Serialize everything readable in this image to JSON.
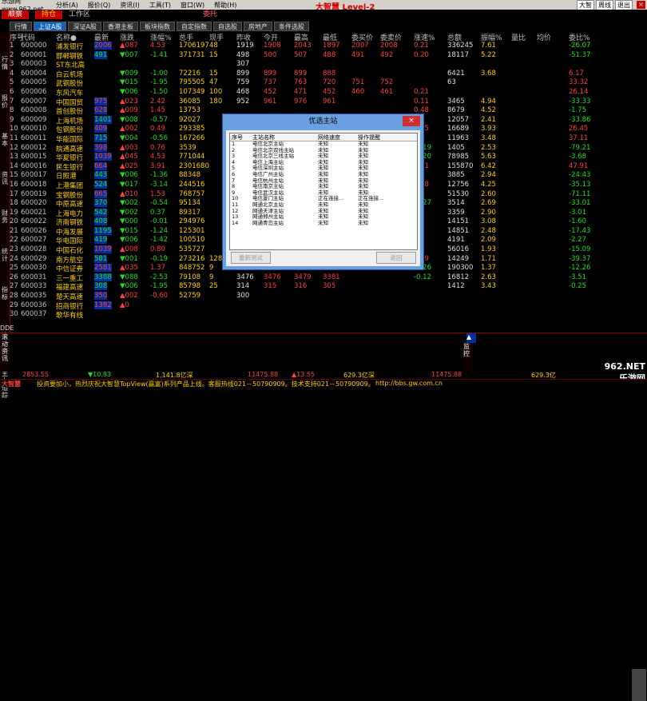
{
  "menubar": {
    "site": "乐游网www.962.net",
    "items": [
      "分析(A)",
      "报价(Q)",
      "资讯(I)",
      "工具(T)",
      "窗口(W)",
      "帮助(H)"
    ],
    "brand": "大智慧 Level-2",
    "right": [
      "大智",
      "周线",
      "退出"
    ],
    "close": "×"
  },
  "toolbar": {
    "tb1": "顺察",
    "tb2": "持仓",
    "tb3": "工作区",
    "tb4": "委托"
  },
  "tabs": [
    "行情",
    "上证A股",
    "深证A股",
    "香港主板",
    "板块指数",
    "自定指数",
    "自选股",
    "房地产",
    "条件选股"
  ],
  "sidebar": [
    "行情",
    "报价",
    "基本",
    "资讯",
    "财务",
    "统计",
    "指标",
    "DDE决策",
    "主力追踪"
  ],
  "header": [
    "序号",
    "代码",
    "名称●",
    "最新",
    "涨跌",
    "涨幅%",
    "总手",
    "现手",
    "昨收",
    "今开",
    "最高",
    "最低",
    "委买价",
    "委卖价",
    "涨速%",
    "总额",
    "振幅%",
    "量比",
    "均价",
    "委比%"
  ],
  "rows": [
    [
      "1",
      "600000",
      "浦发银行",
      "2006",
      "▲087",
      "4.53",
      "1706197",
      "48",
      "1919",
      "1908",
      "2043",
      "1897",
      "2007",
      "2008",
      "0.21",
      "336245",
      "7.61",
      "",
      "",
      "-26.07"
    ],
    [
      "2",
      "600001",
      "邯郸钢铁",
      "491",
      "▼007",
      "-1.41",
      "371731",
      "15",
      "498",
      "500",
      "507",
      "488",
      "491",
      "492",
      "0.20",
      "18117",
      "5.22",
      "",
      "",
      "-51.37"
    ],
    [
      "3",
      "600003",
      "ST东北高",
      "",
      "",
      "",
      "",
      "",
      "307",
      "",
      "",
      "",
      "",
      "",
      "",
      "",
      "",
      "",
      "",
      ""
    ],
    [
      "4",
      "600004",
      "白云机场",
      "",
      "▼009",
      "-1.00",
      "72216",
      "15",
      "899",
      "899",
      "899",
      "888",
      "",
      "",
      "",
      "6421",
      "3.68",
      "",
      "",
      "6.17"
    ],
    [
      "5",
      "600005",
      "武钢股份",
      "",
      "▼015",
      "-1.95",
      "795505",
      "47",
      "759",
      "737",
      "763",
      "720",
      "751",
      "752",
      "",
      "63",
      "",
      "",
      "",
      "33.32"
    ],
    [
      "6",
      "600006",
      "东风汽车",
      "",
      "▼006",
      "-1.50",
      "107349",
      "100",
      "468",
      "452",
      "471",
      "452",
      "460",
      "461",
      "0.21",
      "",
      "",
      "",
      "",
      "26.14"
    ],
    [
      "7",
      "600007",
      "中国国贸",
      "975",
      "▲023",
      "2.42",
      "36085",
      "180",
      "952",
      "961",
      "976",
      "961",
      "",
      "",
      "0.11",
      "3465",
      "4.94",
      "",
      "",
      "-33.33"
    ],
    [
      "8",
      "600008",
      "首创股份",
      "628",
      "▲009",
      "1.45",
      "13753",
      "",
      "",
      "",
      "",
      "",
      "",
      "",
      "0.48",
      "8679",
      "4.52",
      "",
      "",
      "-1.75"
    ],
    [
      "9",
      "600009",
      "上海机场",
      "1401",
      "▼008",
      "-0.57",
      "92027",
      "",
      "",
      "",
      "",
      "",
      "",
      "",
      "",
      "12057",
      "2.41",
      "",
      "",
      "-33.86"
    ],
    [
      "10",
      "600010",
      "包钢股份",
      "409",
      "▲002",
      "0.49",
      "293385",
      "",
      "",
      "",
      "",
      "",
      "",
      "",
      "0.25",
      "16689",
      "3.93",
      "",
      "",
      "26.45"
    ],
    [
      "11",
      "600011",
      "华能国际",
      "715",
      "▼004",
      "-0.56",
      "167266",
      "",
      "",
      "",
      "",
      "",
      "",
      "",
      "",
      "11963",
      "3.48",
      "",
      "",
      "37.11"
    ],
    [
      "12",
      "600012",
      "皖通高速",
      "398",
      "▲003",
      "0.76",
      "3539",
      "",
      "",
      "",
      "",
      "",
      "",
      "",
      "-0.19",
      "1405",
      "2.53",
      "",
      "",
      "-79.21"
    ],
    [
      "13",
      "600015",
      "华夏银行",
      "1039",
      "▲045",
      "4.53",
      "771044",
      "",
      "",
      "",
      "",
      "",
      "",
      "",
      "-0.20",
      "78985",
      "5.63",
      "",
      "",
      "-3.68"
    ],
    [
      "14",
      "600016",
      "民生银行",
      "664",
      "▲025",
      "3.91",
      "2301680",
      "",
      "",
      "",
      "",
      "",
      "",
      "",
      "0.31",
      "155870",
      "6.42",
      "",
      "",
      "47.91"
    ],
    [
      "15",
      "600017",
      "日照港",
      "443",
      "▼006",
      "-1.36",
      "88348",
      "",
      "",
      "",
      "",
      "",
      "",
      "",
      "",
      "3885",
      "2.94",
      "",
      "",
      "-24.43"
    ],
    [
      "16",
      "600018",
      "上港集团",
      "524",
      "▼017",
      "-3.14",
      "244516",
      "",
      "",
      "",
      "",
      "",
      "",
      "",
      "0.18",
      "12756",
      "4.25",
      "",
      "",
      "-35.13"
    ],
    [
      "17",
      "600019",
      "宝钢股份",
      "665",
      "▲010",
      "1.53",
      "768757",
      "",
      "",
      "",
      "",
      "",
      "",
      "",
      "",
      "51530",
      "2.60",
      "",
      "",
      "-71.11"
    ],
    [
      "18",
      "600020",
      "中原高速",
      "370",
      "▼002",
      "-0.54",
      "95134",
      "",
      "",
      "",
      "",
      "",
      "",
      "",
      "-0.27",
      "3514",
      "2.69",
      "",
      "",
      "-33.01"
    ],
    [
      "19",
      "600021",
      "上海电力",
      "542",
      "▼002",
      "0.37",
      "89317",
      "",
      "",
      "",
      "",
      "",
      "",
      "",
      "",
      "3359",
      "2.90",
      "",
      "",
      "-3.01"
    ],
    [
      "20",
      "600022",
      "济南钢铁",
      "408",
      "▼000",
      "-0.01",
      "294976",
      "",
      "",
      "",
      "",
      "",
      "",
      "",
      "",
      "14151",
      "3.08",
      "",
      "",
      "-1.60"
    ],
    [
      "21",
      "600026",
      "中海发展",
      "1195",
      "▼015",
      "-1.24",
      "125301",
      "",
      "",
      "",
      "",
      "",
      "",
      "",
      "",
      "14851",
      "2.48",
      "",
      "",
      "-17.43"
    ],
    [
      "22",
      "600027",
      "华电国际",
      "419",
      "▼006",
      "-1.42",
      "100510",
      "",
      "",
      "",
      "",
      "",
      "",
      "",
      "",
      "4191",
      "2.09",
      "",
      "",
      "-2.27"
    ],
    [
      "23",
      "600028",
      "中国石化",
      "1039",
      "▲008",
      "0.80",
      "535727",
      "",
      "",
      "",
      "",
      "",
      "",
      "",
      "",
      "56016",
      "1.93",
      "",
      "",
      "-15.09"
    ],
    [
      "24",
      "600029",
      "南方航空",
      "581",
      "▼001",
      "-0.19",
      "273216",
      "128",
      "519",
      "521",
      "530",
      "506",
      "",
      "",
      "0.19",
      "14249",
      "1.71",
      "",
      "",
      "-39.37"
    ],
    [
      "25",
      "600030",
      "中信证券",
      "2581",
      "▲035",
      "1.37",
      "848752",
      "9",
      "2546",
      "2546",
      "2598",
      "2532",
      "",
      "",
      "-0.26",
      "190300",
      "1.37",
      "",
      "",
      "-12.26"
    ],
    [
      "26",
      "600031",
      "三一重工",
      "3388",
      "▼088",
      "-2.53",
      "79108",
      "9",
      "3476",
      "3476",
      "3479",
      "3381",
      "",
      "",
      "-0.12",
      "16812",
      "2.63",
      "",
      "",
      "-3.51"
    ],
    [
      "27",
      "600033",
      "福建高速",
      "308",
      "▼006",
      "-1.95",
      "85798",
      "25",
      "314",
      "315",
      "316",
      "305",
      "",
      "",
      "",
      "1412",
      "3.43",
      "",
      "",
      "-0.25"
    ],
    [
      "28",
      "600035",
      "楚天高速",
      "350",
      "▲002",
      "-0.60",
      "52759",
      "",
      "300",
      "",
      "",
      "",
      "",
      "",
      "",
      "",
      "",
      "",
      "",
      ""
    ],
    [
      "29",
      "600036",
      "招商银行",
      "1382",
      "▲0",
      "",
      "",
      "",
      "",
      "",
      "",
      "",
      "",
      "",
      "",
      "",
      "",
      "",
      "",
      ""
    ],
    [
      "30",
      "600037",
      "歌华有线",
      "",
      "",
      "",
      "",
      "",
      "",
      "",
      "",
      "",
      "",
      "",
      "",
      "",
      "",
      "",
      "",
      ""
    ]
  ],
  "dialog": {
    "title": "优选主站",
    "close": "×",
    "columns": [
      "序号",
      "主站名称",
      "网络速度",
      "操作提醒"
    ],
    "rows": [
      [
        "1",
        "电信北京主站",
        "未知",
        "未知"
      ],
      [
        "2",
        "电信北京双线主站",
        "未知",
        "未知"
      ],
      [
        "3",
        "电信北京三线主站",
        "未知",
        "未知"
      ],
      [
        "4",
        "电信上海主站",
        "未知",
        "未知"
      ],
      [
        "5",
        "电信深圳主站",
        "未知",
        "未知"
      ],
      [
        "6",
        "电信广州主站",
        "未知",
        "未知"
      ],
      [
        "7",
        "电信杭州主站",
        "未知",
        "未知"
      ],
      [
        "8",
        "电信南京主站",
        "未知",
        "未知"
      ],
      [
        "9",
        "电信武汉主站",
        "未知",
        "未知"
      ],
      [
        "10",
        "电信厦门主站",
        "正在连接...",
        "正在连接..."
      ],
      [
        "11",
        "网通北京主站",
        "未知",
        "未知"
      ],
      [
        "12",
        "网通天津主站",
        "未知",
        "未知"
      ],
      [
        "13",
        "网通郑州主站",
        "未知",
        "未知"
      ],
      [
        "14",
        "网通青岛主站",
        "未知",
        "未知"
      ]
    ],
    "btn_test": "重新测试",
    "btn_close": "返回"
  },
  "bottom": {
    "left_tab": "滚动资讯",
    "right_tab": "监控",
    "arrow": "▲"
  },
  "ticker": {
    "a": "2853.55",
    "b": "▼10.83",
    "c": "1,141.8亿深",
    "d": "11475.88",
    "e": "▲13.55",
    "f": "629.3亿深",
    "g": "11475.88",
    "h": "629.3亿"
  },
  "status": {
    "left": "大智慧",
    "text": "投资要加小，热烈庆祝大智慧TopView(赢富)系列产品上线。客服热线021－50790909。技术支持021－50790909。",
    "url": "http://bbs.gw.com.cn"
  },
  "watermark": "962.NET 乐游网"
}
